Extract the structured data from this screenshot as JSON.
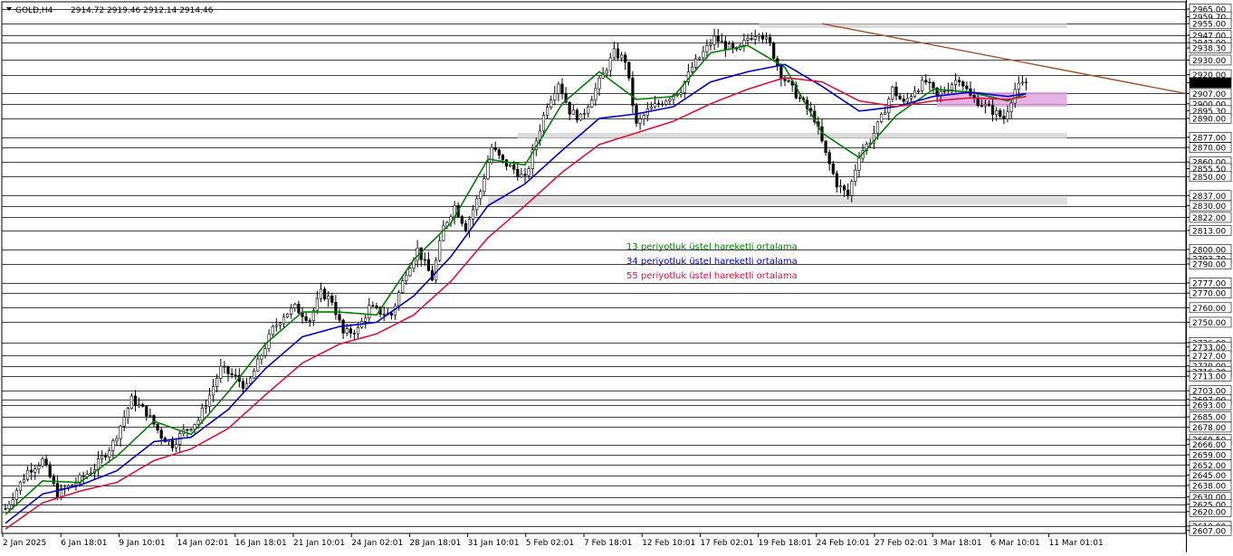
{
  "header": {
    "symbol": "GOLD,H4",
    "ohlc": "2914.72 2919.46 2912.14 2914.46"
  },
  "colors": {
    "background": "#ffffff",
    "candle": "#000000",
    "ema13": "#008000",
    "ema34": "#0000cd",
    "ema55": "#dc143c",
    "trendline": "#a0522d",
    "zone_gray": "#d3d3d3",
    "zone_purple": "#dda0dd",
    "grid": "#000000",
    "axis_bg": "#ffffff",
    "current_price_bg": "#000000"
  },
  "chart_data": {
    "type": "candlestick",
    "instrument": "GOLD",
    "timeframe": "H4",
    "ylim": [
      2605,
      2970
    ],
    "current_price": 2914.46,
    "y_ticks": [
      2965.0,
      2959.7,
      2955.0,
      2947.0,
      2942.0,
      2938.3,
      2930.0,
      2920.0,
      2914.46,
      2907.0,
      2900.0,
      2895.3,
      2890.0,
      2877.0,
      2870.0,
      2860.0,
      2855.5,
      2850.0,
      2837.0,
      2830.0,
      2822.0,
      2813.0,
      2800.0,
      2793.7,
      2790.0,
      2777.0,
      2770.0,
      2760.0,
      2750.0,
      2736.0,
      2733.0,
      2727.0,
      2720.0,
      2716.2,
      2713.0,
      2703.0,
      2697.0,
      2693.0,
      2685.0,
      2678.0,
      2669.5,
      2666.0,
      2659.0,
      2652.0,
      2645.0,
      2638.0,
      2630.0,
      2625.0,
      2620.0,
      2610.0,
      2607.0
    ],
    "x_ticks": [
      "2 Jan 2025",
      "6 Jan 18:01",
      "9 Jan 10:01",
      "14 Jan 02:01",
      "16 Jan 18:01",
      "21 Jan 10:01",
      "24 Jan 02:01",
      "28 Jan 18:01",
      "31 Jan 10:01",
      "5 Feb 02:01",
      "7 Feb 18:01",
      "12 Feb 10:01",
      "17 Feb 02:01",
      "19 Feb 18:01",
      "24 Feb 10:01",
      "27 Feb 02:01",
      "3 Mar 18:01",
      "6 Mar 10:01",
      "11 Mar 01:01"
    ],
    "close_path": [
      [
        0,
        2622
      ],
      [
        6,
        2648
      ],
      [
        10,
        2655
      ],
      [
        14,
        2632
      ],
      [
        19,
        2640
      ],
      [
        24,
        2650
      ],
      [
        29,
        2667
      ],
      [
        34,
        2697
      ],
      [
        38,
        2688
      ],
      [
        42,
        2672
      ],
      [
        45,
        2666
      ],
      [
        48,
        2675
      ],
      [
        52,
        2683
      ],
      [
        55,
        2700
      ],
      [
        58,
        2718
      ],
      [
        62,
        2712
      ],
      [
        65,
        2705
      ],
      [
        68,
        2722
      ],
      [
        72,
        2745
      ],
      [
        75,
        2755
      ],
      [
        78,
        2760
      ],
      [
        82,
        2752
      ],
      [
        85,
        2770
      ],
      [
        88,
        2765
      ],
      [
        91,
        2742
      ],
      [
        95,
        2745
      ],
      [
        98,
        2760
      ],
      [
        101,
        2757
      ],
      [
        104,
        2755
      ],
      [
        108,
        2785
      ],
      [
        111,
        2800
      ],
      [
        115,
        2780
      ],
      [
        118,
        2815
      ],
      [
        121,
        2830
      ],
      [
        124,
        2815
      ],
      [
        128,
        2840
      ],
      [
        131,
        2870
      ],
      [
        134,
        2860
      ],
      [
        137,
        2855
      ],
      [
        140,
        2848
      ],
      [
        143,
        2875
      ],
      [
        146,
        2900
      ],
      [
        149,
        2915
      ],
      [
        152,
        2895
      ],
      [
        155,
        2890
      ],
      [
        158,
        2905
      ],
      [
        161,
        2920
      ],
      [
        164,
        2935
      ],
      [
        167,
        2930
      ],
      [
        170,
        2885
      ],
      [
        173,
        2895
      ],
      [
        176,
        2900
      ],
      [
        179,
        2905
      ],
      [
        182,
        2910
      ],
      [
        185,
        2925
      ],
      [
        188,
        2935
      ],
      [
        191,
        2945
      ],
      [
        194,
        2940
      ],
      [
        197,
        2935
      ],
      [
        200,
        2945
      ],
      [
        203,
        2950
      ],
      [
        206,
        2940
      ],
      [
        209,
        2920
      ],
      [
        212,
        2910
      ],
      [
        215,
        2900
      ],
      [
        218,
        2890
      ],
      [
        221,
        2865
      ],
      [
        224,
        2845
      ],
      [
        227,
        2837
      ],
      [
        230,
        2865
      ],
      [
        233,
        2875
      ],
      [
        236,
        2890
      ],
      [
        239,
        2910
      ],
      [
        242,
        2900
      ],
      [
        245,
        2910
      ],
      [
        248,
        2915
      ],
      [
        251,
        2905
      ],
      [
        254,
        2912
      ],
      [
        257,
        2918
      ],
      [
        260,
        2905
      ],
      [
        263,
        2900
      ],
      [
        266,
        2895
      ],
      [
        269,
        2890
      ],
      [
        272,
        2910
      ],
      [
        275,
        2914.46
      ]
    ],
    "series": [
      {
        "name": "13 periyotluk üstel hareketli ortalama",
        "x": [
          0,
          10,
          20,
          30,
          40,
          50,
          60,
          70,
          80,
          90,
          100,
          110,
          120,
          130,
          140,
          150,
          160,
          170,
          180,
          190,
          200,
          210,
          220,
          230,
          240,
          250,
          260,
          270,
          275
        ],
        "values": [
          2618,
          2641,
          2640,
          2658,
          2682,
          2673,
          2702,
          2735,
          2757,
          2757,
          2755,
          2793,
          2818,
          2862,
          2858,
          2900,
          2922,
          2903,
          2905,
          2935,
          2940,
          2925,
          2880,
          2863,
          2892,
          2910,
          2908,
          2902,
          2907
        ]
      },
      {
        "name": "34 periyotluk üstel hareketli ortalama",
        "x": [
          0,
          10,
          20,
          30,
          40,
          50,
          60,
          70,
          80,
          90,
          100,
          110,
          120,
          130,
          140,
          150,
          160,
          170,
          180,
          190,
          200,
          210,
          220,
          230,
          240,
          250,
          260,
          270,
          275
        ],
        "values": [
          2612,
          2632,
          2638,
          2648,
          2668,
          2671,
          2690,
          2718,
          2740,
          2747,
          2750,
          2768,
          2795,
          2830,
          2845,
          2868,
          2890,
          2893,
          2898,
          2915,
          2922,
          2927,
          2912,
          2895,
          2898,
          2905,
          2908,
          2905,
          2907
        ]
      },
      {
        "name": "55 periyotluk üstel hareketli ortalama",
        "x": [
          0,
          10,
          20,
          30,
          40,
          50,
          60,
          70,
          80,
          90,
          100,
          110,
          120,
          130,
          140,
          150,
          160,
          170,
          180,
          190,
          200,
          210,
          220,
          230,
          240,
          250,
          260,
          270,
          275
        ],
        "values": [
          2608,
          2626,
          2634,
          2640,
          2655,
          2663,
          2677,
          2700,
          2722,
          2735,
          2742,
          2755,
          2778,
          2808,
          2830,
          2853,
          2872,
          2880,
          2888,
          2900,
          2910,
          2918,
          2915,
          2902,
          2898,
          2902,
          2904,
          2903,
          2905
        ]
      }
    ],
    "horizontal_lines": [
      2965.0,
      2955.0,
      2947.0,
      2942.0,
      2930.0,
      2920.0,
      2907.0,
      2900.0,
      2890.0,
      2877.0,
      2870.0,
      2860.0,
      2850.0,
      2837.0,
      2830.0,
      2822.0,
      2813.0,
      2800.0,
      2790.0,
      2777.0,
      2770.0,
      2760.0,
      2750.0,
      2736.0,
      2727.0,
      2720.0,
      2713.0,
      2703.0,
      2697.0,
      2693.0,
      2685.0,
      2678.0,
      2666.0,
      2659.0,
      2652.0,
      2645.0,
      2638.0,
      2630.0,
      2625.0,
      2620.0,
      2610.0
    ],
    "zones": [
      {
        "kind": "resistance",
        "x_from": 203,
        "x_to": 286,
        "y_from": 2955,
        "y_to": 2952,
        "color": "gray"
      },
      {
        "kind": "range",
        "x_from": 251,
        "x_to": 286,
        "y_from": 2908,
        "y_to": 2898,
        "color": "purple"
      },
      {
        "kind": "support",
        "x_from": 138,
        "x_to": 286,
        "y_from": 2880,
        "y_to": 2876,
        "color": "gray"
      },
      {
        "kind": "support",
        "x_from": 130,
        "x_to": 286,
        "y_from": 2836,
        "y_to": 2831,
        "color": "gray"
      }
    ],
    "trendline": {
      "x_from": 220,
      "y_from": 2955,
      "x_to": 318,
      "y_to": 2907
    },
    "legend": [
      {
        "label": "13 periyotluk üstel hareketli ortalama",
        "color": "#008000"
      },
      {
        "label": "34 periyotluk üstel hareketli ortalama",
        "color": "#0000cd"
      },
      {
        "label": "55 periyotluk üstel hareketli ortalama",
        "color": "#dc143c"
      }
    ],
    "legend_placement": "center"
  }
}
